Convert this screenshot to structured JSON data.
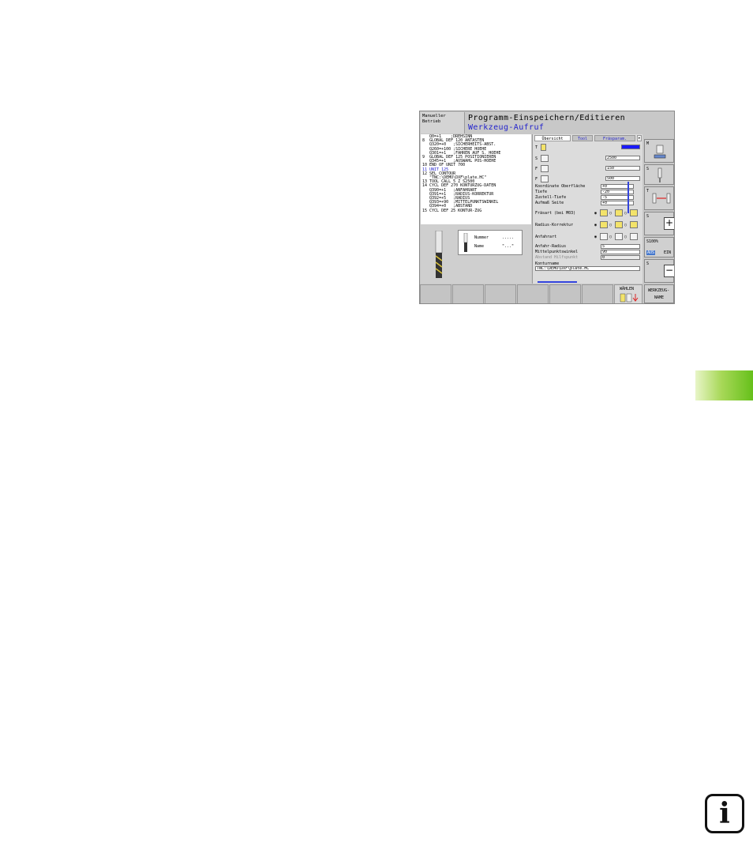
{
  "mode": {
    "line1": "Manueller",
    "line2": "Betrieb"
  },
  "title": {
    "line1": "Programm-Einspeichern/Editieren",
    "line2": "Werkzeug-Aufruf"
  },
  "program_lines": [
    {
      "text": "   Q0=+1    ;DREHSINN",
      "hl": false
    },
    {
      "text": "8  GLOBAL DEF 120 ANTASTEN",
      "hl": false
    },
    {
      "text": "   Q320=+0   ;SICHERHEITS-ABST.",
      "hl": false
    },
    {
      "text": "   Q260=+100 ;SICHERE HOEHE",
      "hl": false
    },
    {
      "text": "   Q301=+1   ;FAHREN AUF S. HOEHE",
      "hl": false
    },
    {
      "text": "9  GLOBAL DEF 125 POSITIONIEREN",
      "hl": false
    },
    {
      "text": "   Q345=+1   ;AUSWAHL POS-HOEHE",
      "hl": false
    },
    {
      "text": "10 END OF UNIT 700",
      "hl": false
    },
    {
      "text": "11 UNIT 125",
      "hl": true
    },
    {
      "text": "12 SEL CONTOUR",
      "hl": false
    },
    {
      "text": "   \"TNC:\\DEMO\\DXF\\plate.HC\"",
      "hl": false
    },
    {
      "text": "13 TOOL CALL 5 Z S2500",
      "hl": false
    },
    {
      "text": "14 CYCL DEF 270 KONTURZUG-DATEN",
      "hl": false
    },
    {
      "text": "   Q390=+1   ;ANFAHRART",
      "hl": false
    },
    {
      "text": "   Q391=+1   ;RADIUS-KORREKTUR",
      "hl": false
    },
    {
      "text": "   Q392=+5   ;RADIUS",
      "hl": false
    },
    {
      "text": "   Q393=+90  ;MITTELPUNKTSWINKEL",
      "hl": false
    },
    {
      "text": "   Q394=+0   ;ABSTAND",
      "hl": false
    },
    {
      "text": "15 CYCL DEF 25 KONTUR-ZUG",
      "hl": false
    }
  ],
  "tool_box": {
    "number_label": "Nummer",
    "number_value": ".....",
    "name_label": "Name",
    "name_value": "\"...\""
  },
  "tabs": [
    "Übersicht",
    "Tool",
    "Fräsparam."
  ],
  "form": {
    "t_label": "T",
    "s_label": "S",
    "s_value": "2500",
    "f1_label": "F",
    "f1_value": "150",
    "f2_label": "F",
    "f2_value": "500",
    "surface_label": "Koordinate Oberfläche",
    "surface_value": "+0",
    "depth_label": "Tiefe",
    "depth_value": "-20",
    "plunge_label": "Zustell-Tiefe",
    "plunge_value": "-5",
    "allow_label": "Aufmaß Seite",
    "allow_value": "+0",
    "millmode_label": "Fräsart (bei M03)",
    "radcomp_label": "Radius-Korrektur",
    "approach_label": "Anfahrart",
    "appr_radius_label": "Anfahr-Radius",
    "appr_radius_value": "5",
    "center_angle_label": "Mittelpunktswinkel",
    "center_angle_value": "90",
    "aux_dist_label": "Abstand Hilfspunkt",
    "aux_dist_value": "0",
    "contour_label": "Konturname",
    "contour_value": "TNC:\\DEMO\\DXF\\plate.HC"
  },
  "right_softkeys": {
    "m": "M",
    "s": "S",
    "t": "T",
    "s_plus": "S",
    "feed": "S100%",
    "aus": "AUS",
    "ein": "EIN",
    "s_minus": "S"
  },
  "bottom_softkeys": {
    "waehlen": "WÄHLEN",
    "werkzeug_line1": "WERKZEUG-",
    "werkzeug_line2": "NAME"
  },
  "info_glyph": "i",
  "colors": {
    "accent": "#2222cc",
    "chapter_tab": "#66c01a"
  }
}
